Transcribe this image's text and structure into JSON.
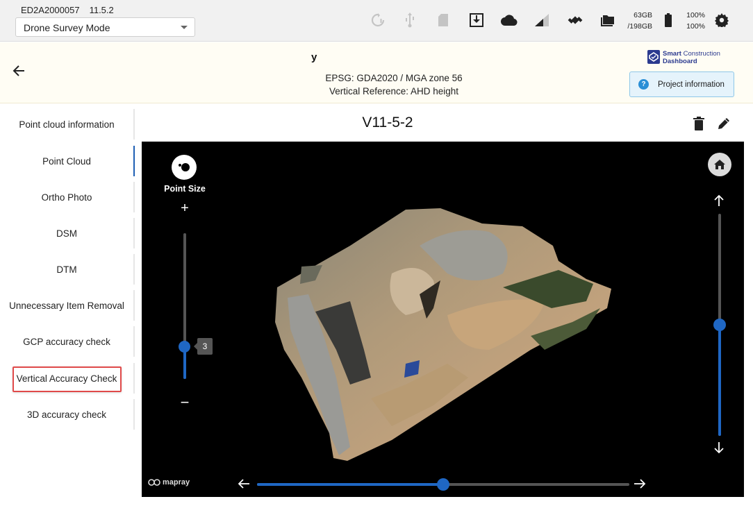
{
  "topbar": {
    "device_id": "ED2A2000057",
    "version": "11.5.2",
    "mode": "Drone Survey Mode",
    "storage_used": "63GB",
    "storage_total": "/198GB",
    "battery_1": "100%",
    "battery_2": "100%",
    "icons": [
      "sync-alert-icon",
      "usb-icon",
      "sd-card-icon",
      "download-box-icon",
      "cloud-icon",
      "signal-icon",
      "satellite-icon",
      "folder-icon",
      "battery-icon",
      "gear-icon"
    ]
  },
  "header": {
    "title_partial": "y",
    "epsg": "EPSG: GDA2020 / MGA zone 56",
    "vertical_reference": "Vertical Reference: AHD height",
    "logo_line1_bold": "Smart",
    "logo_line1_rest": " Construction",
    "logo_line2": "Dashboard",
    "project_info_label": "Project information"
  },
  "sidenav": {
    "active_index": 1,
    "highlighted_index": 7,
    "items": [
      {
        "label": "Point cloud information"
      },
      {
        "label": "Point Cloud"
      },
      {
        "label": "Ortho Photo"
      },
      {
        "label": "DSM"
      },
      {
        "label": "DTM"
      },
      {
        "label": "Unnecessary Item Removal"
      },
      {
        "label": "GCP accuracy check"
      },
      {
        "label": "Vertical Accuracy Check"
      },
      {
        "label": "3D accuracy check"
      }
    ]
  },
  "content": {
    "title": "V11-5-2"
  },
  "viewer": {
    "point_size_label": "Point Size",
    "point_size_value": "3",
    "point_size_min": 1,
    "point_size_max": 10,
    "vertical_level": 0.5,
    "horizontal_level": 0.5,
    "attribution": "mapray"
  },
  "colors": {
    "accent": "#1f67c4",
    "highlight": "#e04a4a",
    "header_bg": "#fffdf4"
  }
}
